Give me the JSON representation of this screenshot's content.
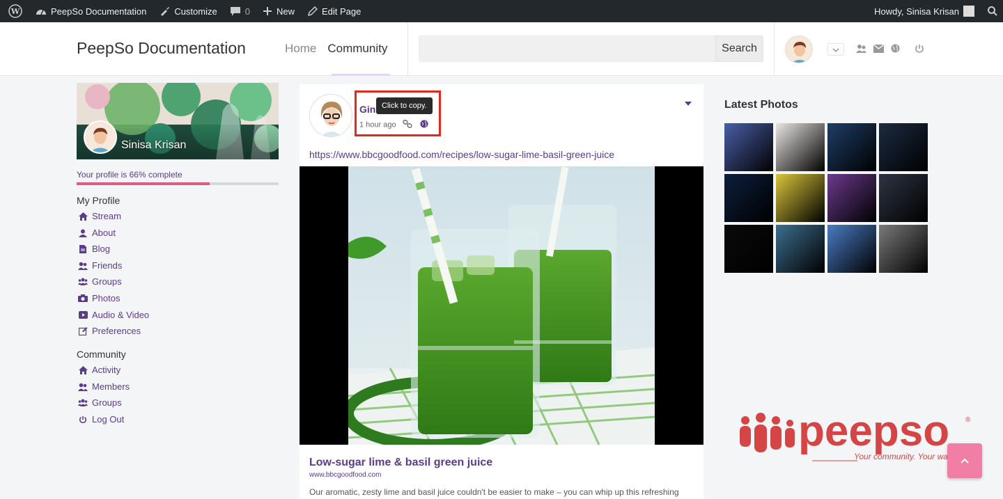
{
  "admin_bar": {
    "site_name": "PeepSo Documentation",
    "customize": "Customize",
    "comments_count": "0",
    "new": "New",
    "edit_page": "Edit Page",
    "howdy": "Howdy, Sinisa Krisan"
  },
  "header": {
    "site_title": "PeepSo Documentation",
    "nav": {
      "home": "Home",
      "community": "Community"
    },
    "search": {
      "placeholder": "",
      "button": "Search"
    }
  },
  "profile": {
    "name": "Sinisa Krisan",
    "completeness_text": "Your profile is 66% complete",
    "completeness": 0.66
  },
  "my_profile_menu": {
    "heading": "My Profile",
    "items": [
      "Stream",
      "About",
      "Blog",
      "Friends",
      "Groups",
      "Photos",
      "Audio & Video",
      "Preferences"
    ]
  },
  "community_menu": {
    "heading": "Community",
    "items": [
      "Activity",
      "Members",
      "Groups",
      "Log Out"
    ]
  },
  "post": {
    "author": "Gin",
    "time": "1 hour ago",
    "tooltip": "Click to copy.",
    "url": "https://www.bbcgoodfood.com/recipes/low-sugar-lime-basil-green-juice",
    "link_title": "Low-sugar lime & basil green juice",
    "link_domain": "www.bbcgoodfood.com",
    "link_description": "Our aromatic, zesty lime and basil juice couldn't be easier to make – you can whip up this refreshing"
  },
  "latest_photos": {
    "heading": "Latest Photos",
    "tile_colors": [
      "#4a5fa8",
      "#e9e6e2",
      "#1f3d66",
      "#1c2b40",
      "#0d1f3c",
      "#d9c53a",
      "#6b3a8e",
      "#2d3442",
      "#0a0a0a",
      "#3c6e8e",
      "#4a7cc4",
      "#7a7a7a"
    ]
  },
  "brand": {
    "logo_text": "peepso",
    "tagline": "Your community. Your way.",
    "accent": "#5b3b8c",
    "brand_red": "#d64545"
  }
}
